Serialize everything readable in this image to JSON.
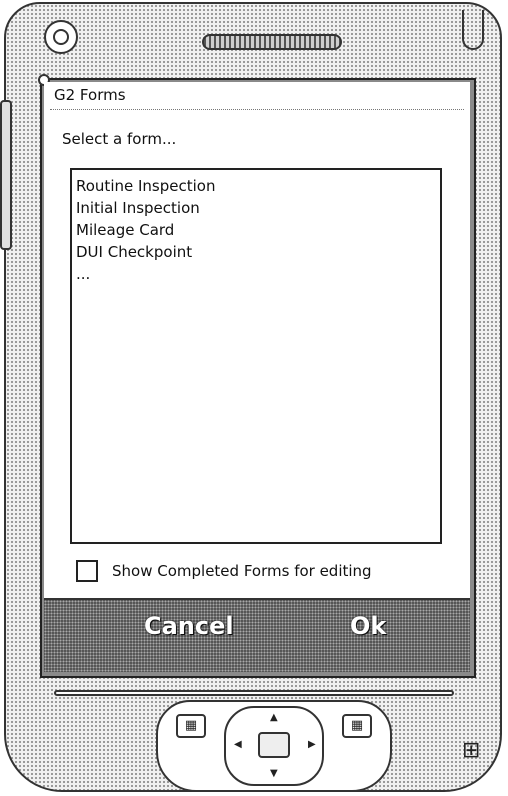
{
  "app": {
    "title": "G2 Forms",
    "prompt": "Select a form..."
  },
  "forms": {
    "items": [
      "Routine Inspection",
      "Initial Inspection",
      "Mileage Card",
      "DUI Checkpoint",
      "..."
    ]
  },
  "options": {
    "show_completed_label": "Show Completed Forms for editing",
    "show_completed_checked": false
  },
  "softkeys": {
    "left": "Cancel",
    "right": "Ok"
  },
  "hardware": {
    "left_button_icon": "calendar-icon",
    "right_button_icon": "contacts-icon",
    "start_icon": "windows-logo-icon",
    "left_button_glyph": "▦",
    "right_button_glyph": "▦",
    "logo_glyph": "⊞"
  }
}
